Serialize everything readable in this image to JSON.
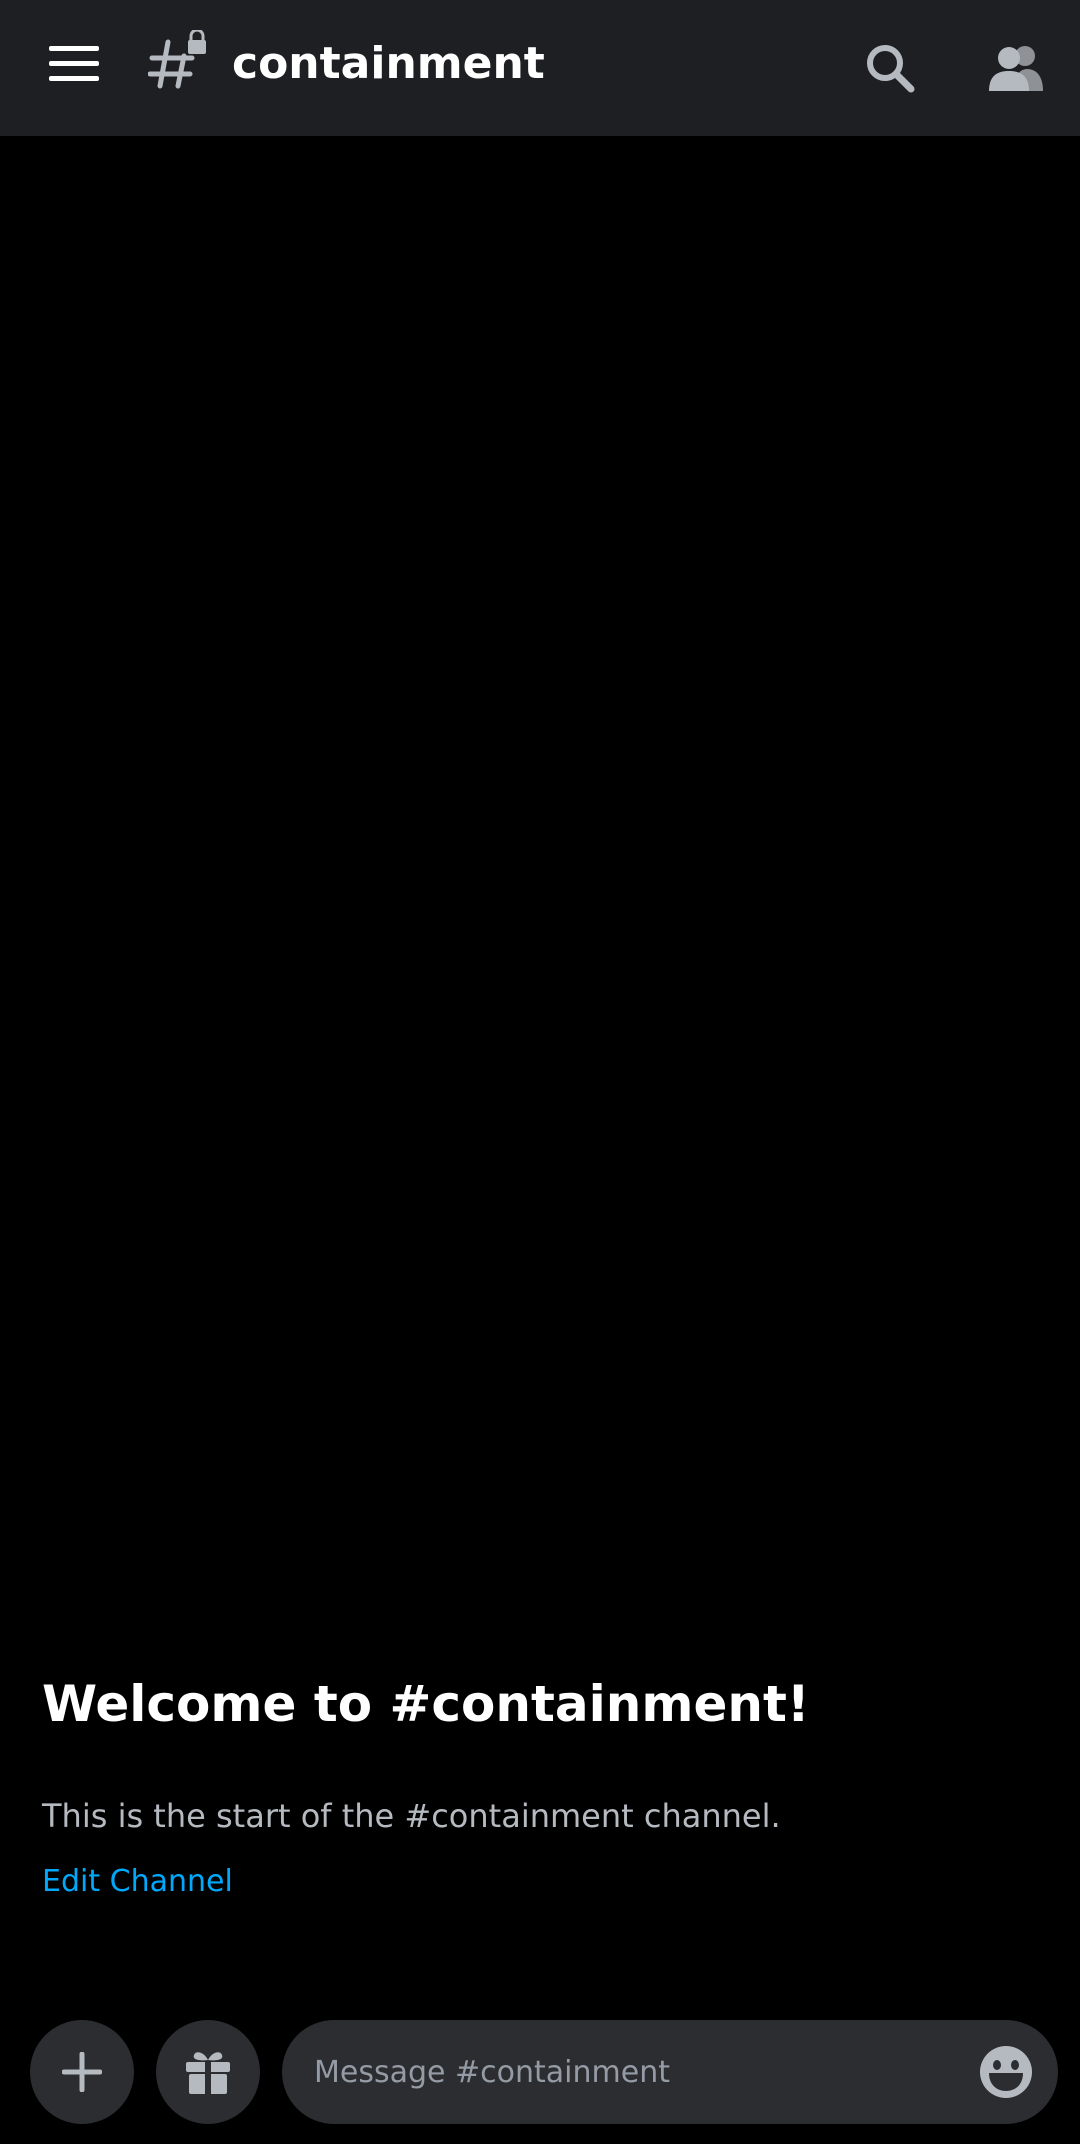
{
  "header": {
    "channel_name": "containment",
    "icons": {
      "menu": "hamburger-menu-icon",
      "channel": "locked-hashtag-icon",
      "search": "search-icon",
      "members": "members-icon"
    }
  },
  "welcome": {
    "title": "Welcome to #containment!",
    "subtitle": "This is the start of the #containment channel.",
    "edit_link": "Edit Channel"
  },
  "composer": {
    "placeholder": "Message #containment",
    "value": "",
    "icons": {
      "attach": "plus-icon",
      "gift": "gift-icon",
      "emoji": "emoji-icon"
    }
  },
  "colors": {
    "background": "#000000",
    "header": "#1e1f22",
    "surface": "#2b2d31",
    "text_primary": "#ffffff",
    "text_muted": "#b5bac1",
    "link": "#00a8fc",
    "icon": "#b5bac1"
  }
}
